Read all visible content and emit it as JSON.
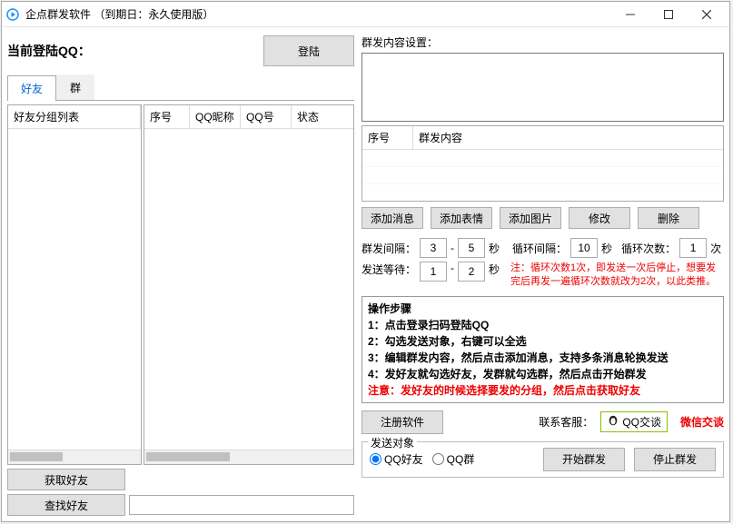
{
  "window": {
    "title": "企点群发软件  （到期日：永久使用版）"
  },
  "login": {
    "label": "当前登陆QQ：",
    "button": "登陆"
  },
  "tabs": {
    "friends": "好友",
    "groups": "群"
  },
  "friendList": {
    "header": "好友分组列表"
  },
  "mainList": {
    "cols": {
      "seq": "序号",
      "nick": "QQ昵称",
      "qq": "QQ号",
      "status": "状态"
    }
  },
  "btns": {
    "getFriends": "获取好友",
    "findFriends": "查找好友",
    "addMsg": "添加消息",
    "addEmoji": "添加表情",
    "addImg": "添加图片",
    "edit": "修改",
    "del": "删除",
    "register": "注册软件",
    "start": "开始群发",
    "stop": "停止群发"
  },
  "msg": {
    "settingLabel": "群发内容设置：",
    "cols": {
      "seq": "序号",
      "content": "群发内容"
    }
  },
  "timing": {
    "intervalLabel": "群发间隔：",
    "min": "3",
    "max": "5",
    "sec": "秒",
    "loopIntervalLabel": "循环间隔：",
    "loopInterval": "10",
    "loopCountLabel": "循环次数：",
    "loopCount": "1",
    "times": "次",
    "waitLabel": "发送等待：",
    "waitMin": "1",
    "waitMax": "2",
    "note": "注：循环次数1次，即发送一次后停止，想要发完后再发一遍循环次数就改为2次，以此类推。"
  },
  "steps": {
    "title": "操作步骤",
    "s1": "1：点击登录扫码登陆QQ",
    "s2": "2：勾选发送对象，右键可以全选",
    "s3": "3：编辑群发内容，然后点击添加消息，支持多条消息轮换发送",
    "s4": "4：发好友就勾选好友，发群就勾选群，然后点击开始群发",
    "note": "注意：发好友的时候选择要发的分组，然后点击获取好友"
  },
  "contact": {
    "label": "联系客服：",
    "qq": "QQ交谈",
    "wx": "微信交谈"
  },
  "send": {
    "legend": "发送对象",
    "friend": "QQ好友",
    "group": "QQ群"
  }
}
